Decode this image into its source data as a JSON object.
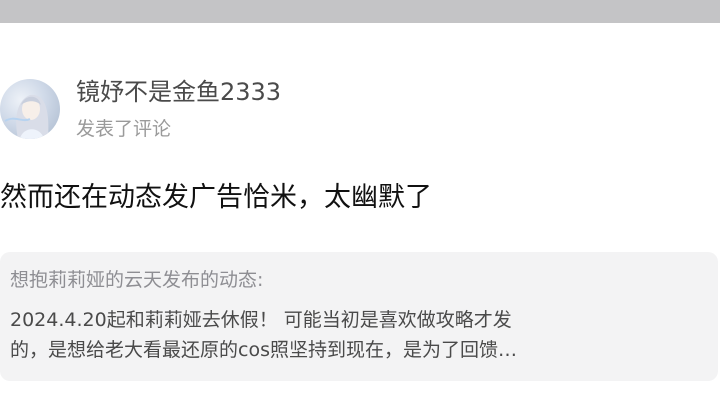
{
  "post": {
    "username": "镜妤不是金鱼2333",
    "action_text": "发表了评论",
    "comment_text": "然而还在动态发广告恰米，太幽默了"
  },
  "quoted_post": {
    "author_line": "想抱莉莉娅的云天发布的动态:",
    "content_lines": [
      "2024.4.20起和莉莉娅去休假！ 可能当初是喜欢做攻略才发",
      "的，是想给老大看最还原的cos照坚持到现在，是为了回馈…"
    ]
  },
  "colors": {
    "top_bar": "#c4c4c6",
    "card_background": "#f3f3f4",
    "secondary_text": "#9a9a9a"
  },
  "icons": {
    "avatar": "user-avatar-anime-girl"
  }
}
